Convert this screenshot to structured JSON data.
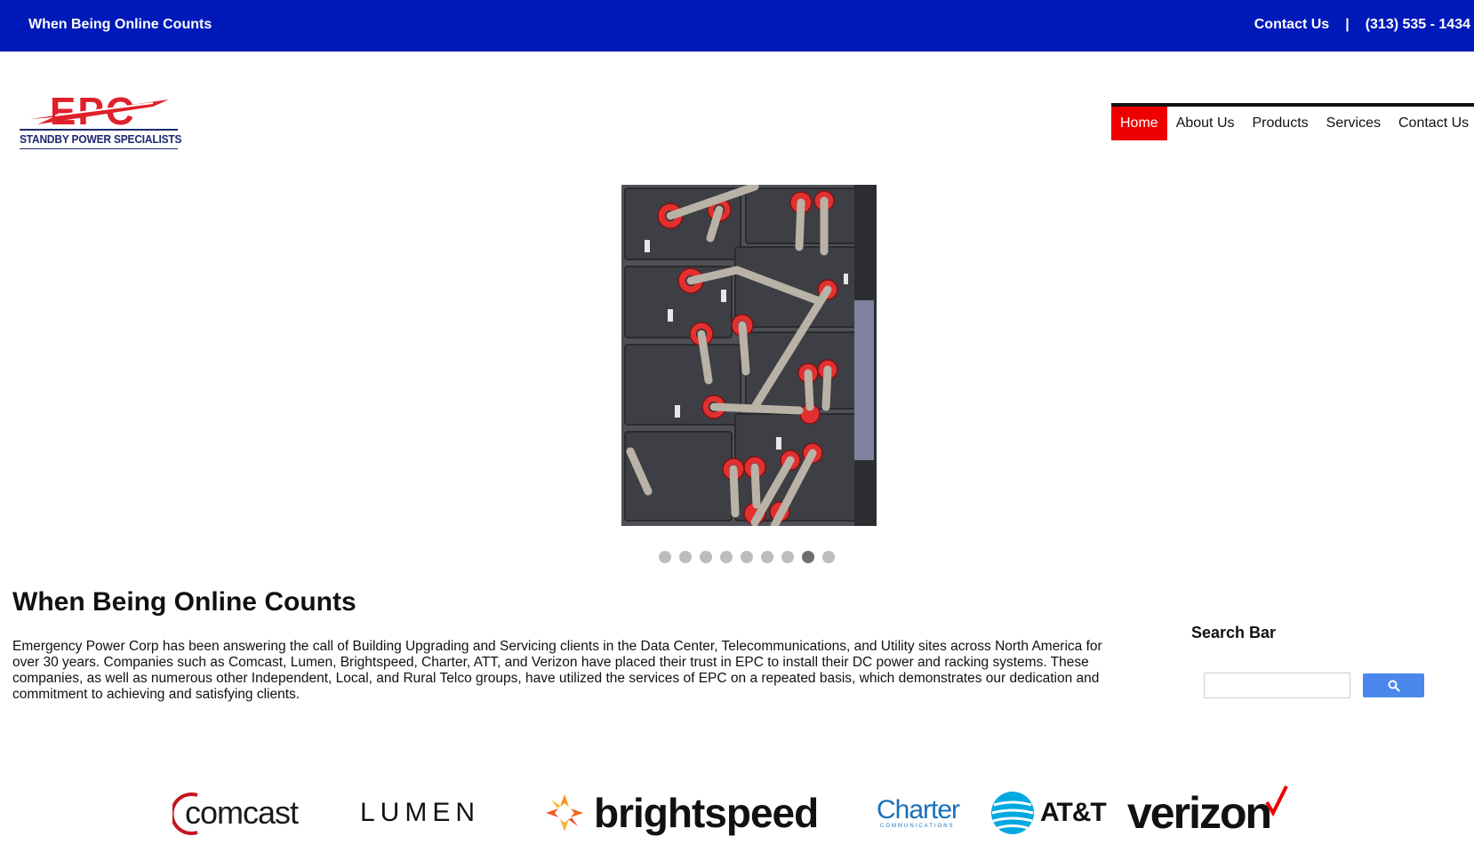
{
  "topbar": {
    "tagline": "When Being Online Counts",
    "contact": "Contact Us",
    "separator": "|",
    "phone": "(313) 535 - 1434"
  },
  "logo": {
    "wordmark": "EPC",
    "subtitle": "STANDBY POWER SPECIALISTS"
  },
  "nav": {
    "items": [
      {
        "label": "Home",
        "active": true
      },
      {
        "label": "About Us",
        "active": false
      },
      {
        "label": "Products",
        "active": false
      },
      {
        "label": "Services",
        "active": false
      },
      {
        "label": "Contact Us",
        "active": false
      }
    ]
  },
  "slideshow": {
    "total": 9,
    "active_index": 7
  },
  "main": {
    "headline": "When Being Online Counts",
    "paragraph": "Emergency Power Corp has been answering the call of Building Upgrading and Servicing clients in the Data Center, Telecommunications, and Utility sites across North America for over 30 years. Companies such as Comcast, Lumen, Brightspeed, Charter, ATT, and Verizon have placed their trust in EPC to install their DC power and racking systems. These companies, as well as numerous other Independent, Local, and Rural Telco groups, have utilized the services of EPC on a repeated basis, which demonstrates our dedication and commitment to achieving and satisfying clients."
  },
  "search": {
    "title": "Search Bar",
    "value": "",
    "icon": "search-icon"
  },
  "clients": {
    "comcast": "comcast",
    "lumen": "LUMEN",
    "brightspeed": "brightspeed",
    "charter": "Charter",
    "charter_sub": "COMMUNICATIONS",
    "att": "AT&T",
    "verizon": "verizon"
  },
  "colors": {
    "topbar": "#0019b9",
    "nav_active": "#ee0000",
    "search_button": "#4a88ee",
    "logo_red": "#e0202a",
    "logo_navy": "#1b2a6e"
  }
}
